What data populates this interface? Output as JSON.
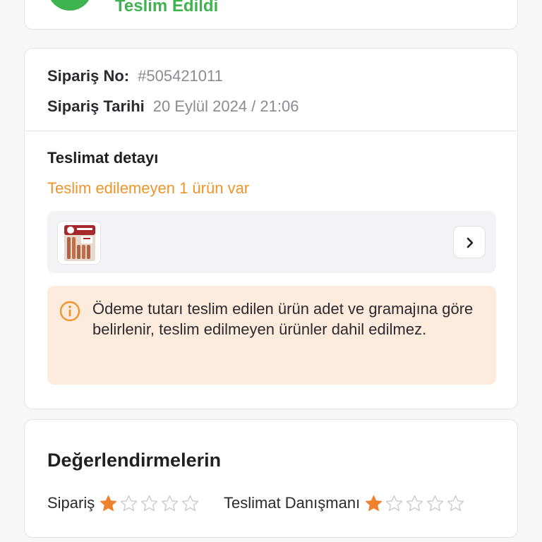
{
  "status": {
    "label": "Teslim Edildi",
    "color": "#3fb34f"
  },
  "order": {
    "number_label": "Sipariş No:",
    "number_value": "#505421011",
    "date_label": "Sipariş Tarihi",
    "date_value": "20 Eylül 2024 / 21:06"
  },
  "delivery": {
    "title": "Teslimat detayı",
    "warning": "Teslim edilemeyen 1 ürün var",
    "warning_color": "#f0952b",
    "product_icon": "sausage-package-thumbnail",
    "open_icon": "chevron-right-icon"
  },
  "info": {
    "icon": "info-circle-icon",
    "text": "Ödeme tutarı teslim edilen ürün adet ve gramajına göre belirlenir, teslim edilmeyen ürünler dahil edilmez."
  },
  "ratings": {
    "title": "Değerlendirmelerin",
    "order_label": "Sipariş",
    "order_stars": 1,
    "courier_label": "Teslimat Danışmanı",
    "courier_stars": 1,
    "max_stars": 5,
    "filled_color": "#f0822e"
  }
}
